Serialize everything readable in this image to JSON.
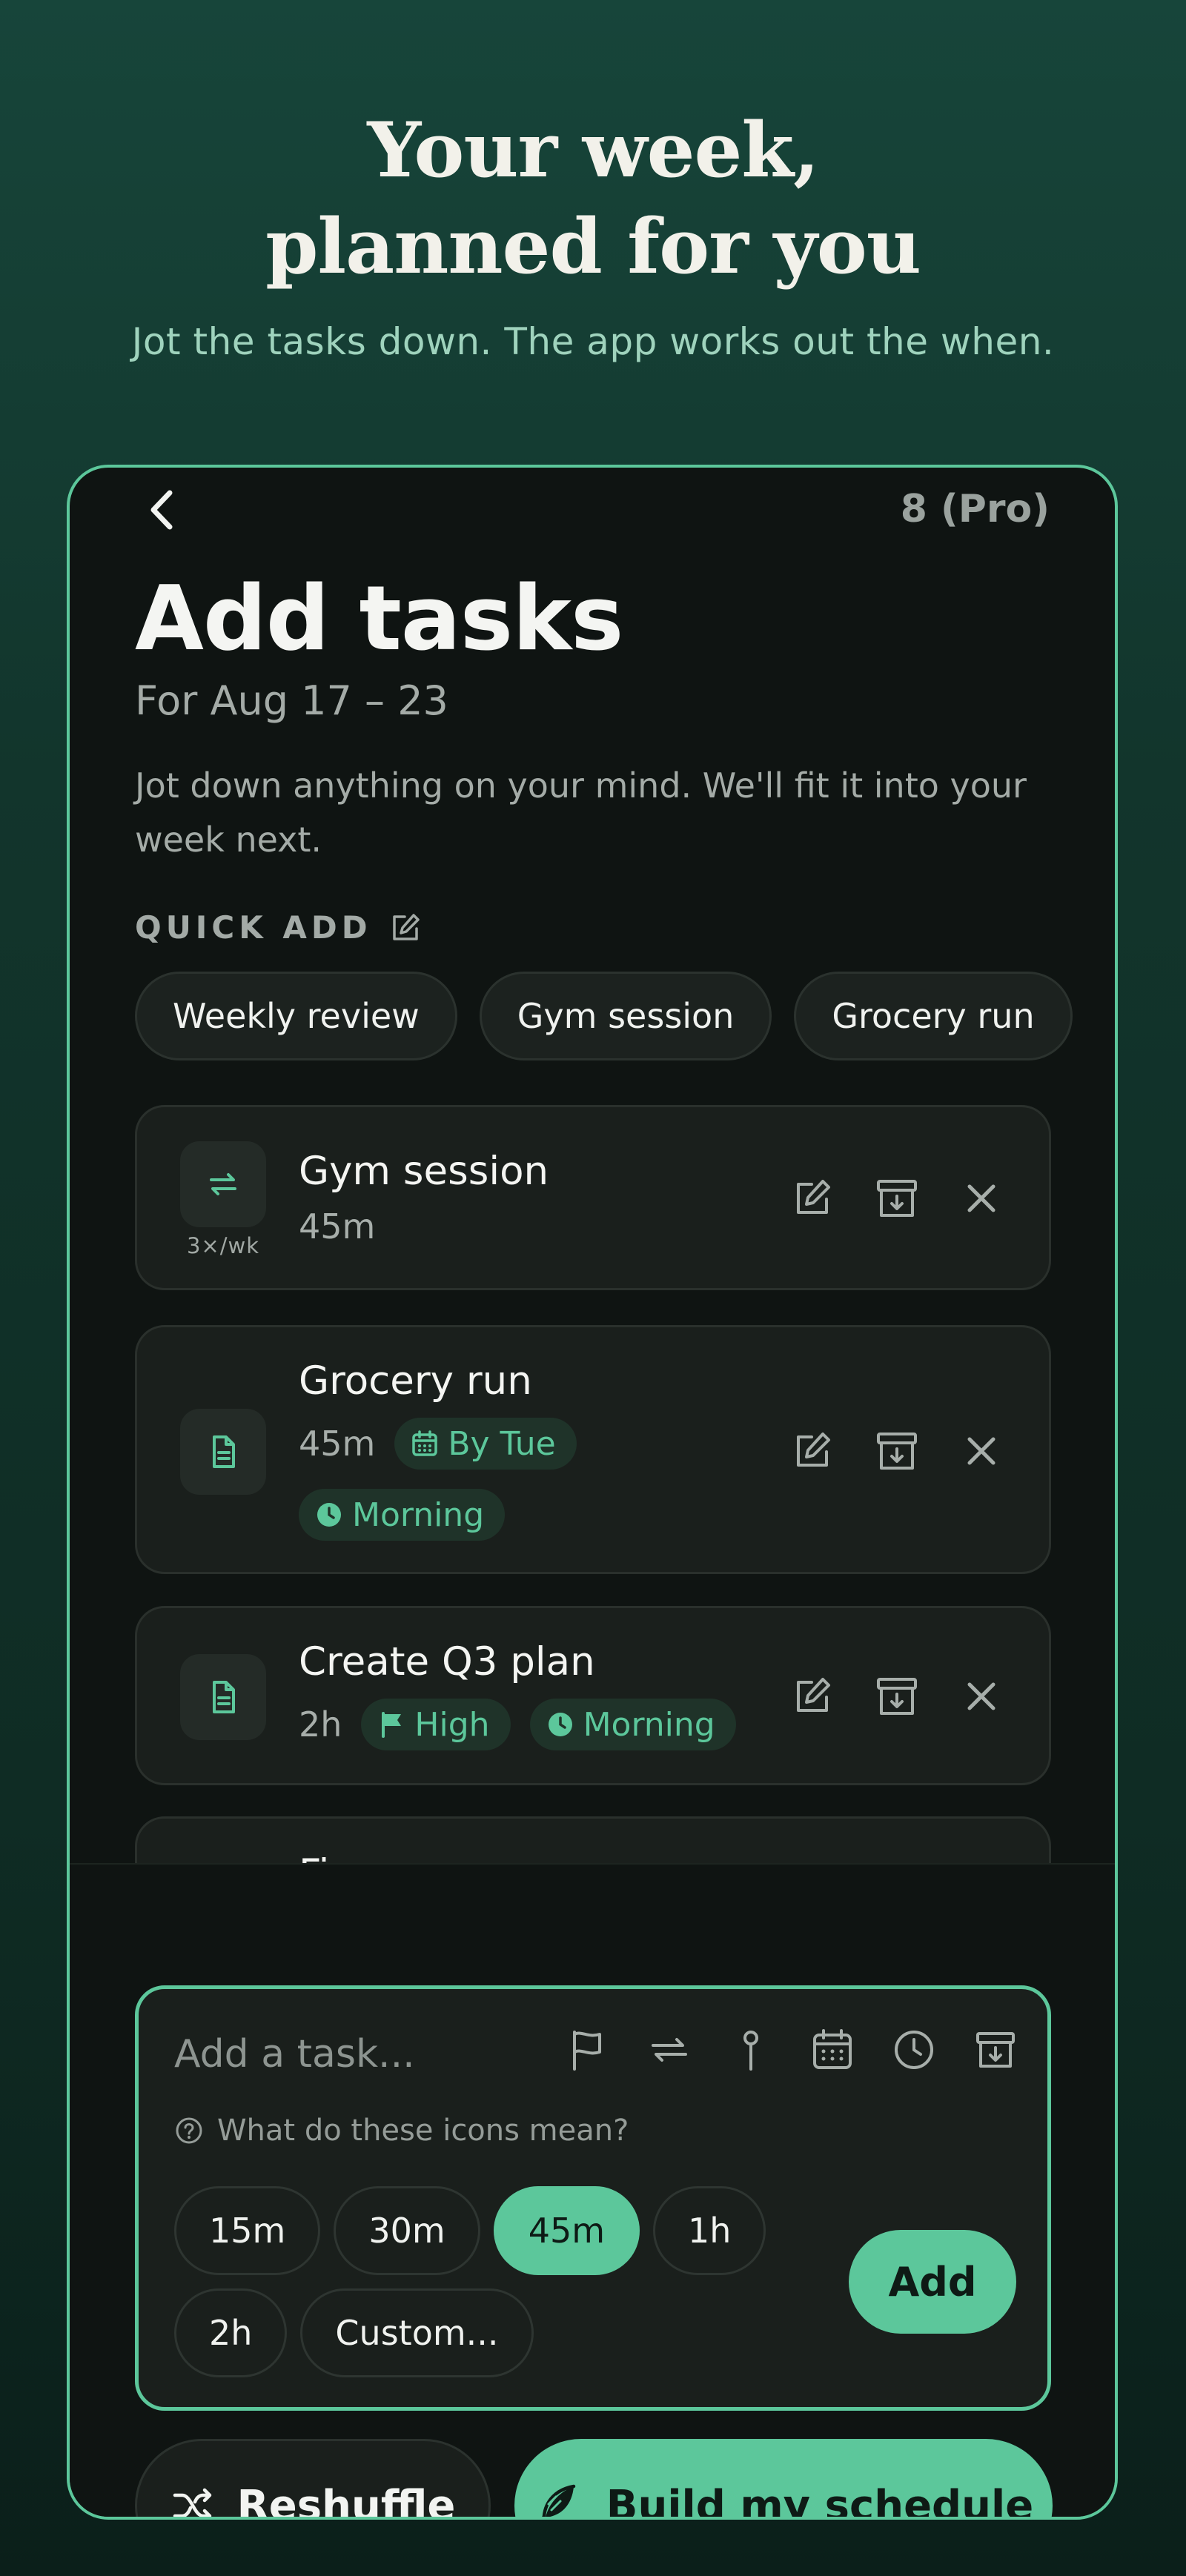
{
  "hero": {
    "title_line1": "Your week,",
    "title_line2": "planned for you",
    "subtitle": "Jot the tasks down. The app works out the when."
  },
  "header": {
    "back_icon": "chevron-left-icon",
    "badge": "8 (Pro)",
    "title": "Add tasks",
    "subtitle": "For Aug 17 – 23",
    "description": "Jot down anything on your mind. We'll fit it into your week next."
  },
  "quick_add": {
    "label": "QUICK ADD",
    "icon": "edit-icon",
    "chips": [
      "Weekly review",
      "Gym session",
      "Grocery run"
    ]
  },
  "tasks": [
    {
      "title": "Gym session",
      "duration": "45m",
      "type_icon": "repeat-icon",
      "frequency": "3×/wk"
    },
    {
      "title": "Grocery run",
      "duration": "45m",
      "type_icon": "document-icon",
      "tags": [
        "By Tue",
        "Morning"
      ]
    },
    {
      "title": "Create Q3 plan",
      "duration": "2h",
      "type_icon": "document-icon",
      "tags": [
        "High",
        "Morning"
      ]
    },
    {
      "title": "Fi..."
    }
  ],
  "composer": {
    "placeholder": "Add a task...",
    "help": "What do these icons mean?",
    "icons": [
      "flag-icon",
      "repeat-icon",
      "pin-icon",
      "calendar-icon",
      "clock-icon",
      "archive-icon"
    ],
    "durations": [
      "15m",
      "30m",
      "45m",
      "1h",
      "2h",
      "Custom..."
    ],
    "selected_duration": "45m",
    "add_label": "Add"
  },
  "footer": {
    "reshuffle_label": "Reshuffle",
    "build_label": "Build my schedule"
  },
  "colors": {
    "accent": "#5cc79b",
    "background_top": "#17453a",
    "card": "#1a1f1c"
  }
}
